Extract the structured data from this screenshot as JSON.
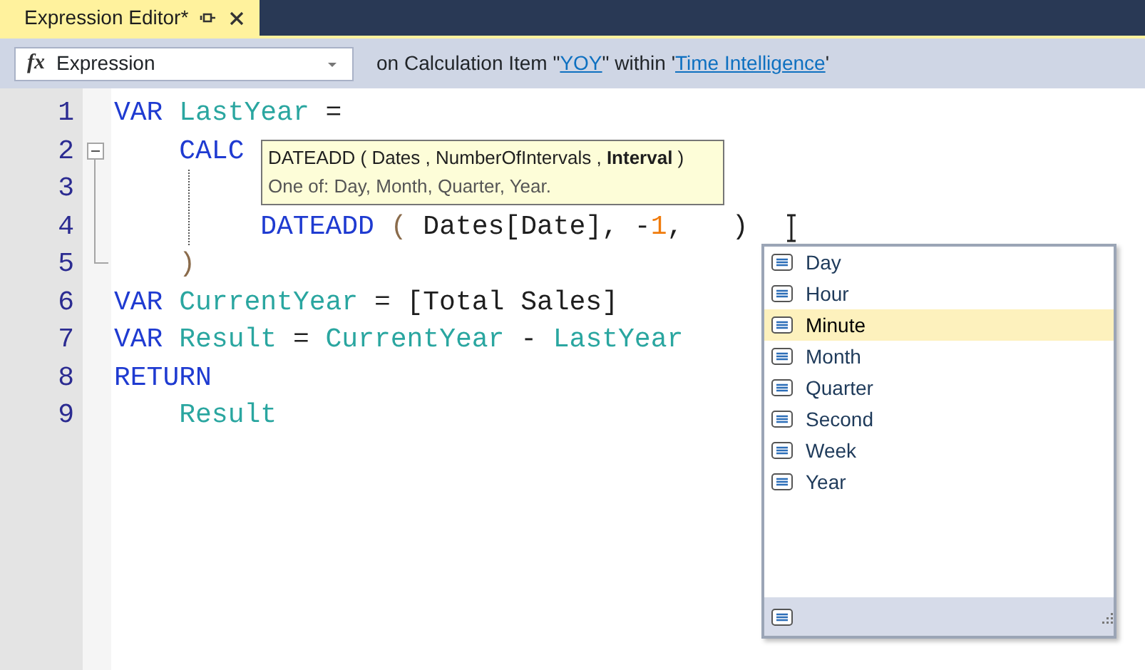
{
  "tab": {
    "title": "Expression Editor*",
    "selected": true
  },
  "toolbar": {
    "property_dropdown": {
      "icon_text": "fx",
      "value": "Expression"
    },
    "context": {
      "prefix": "on Calculation Item \"",
      "item_link": "YOY",
      "middle": "\" within '",
      "table_link": "Time Intelligence",
      "suffix": "'"
    }
  },
  "code_lines": [
    {
      "number": "1",
      "kind": "plain",
      "tokens": [
        {
          "kind": "keyword",
          "text": "VAR"
        },
        {
          "kind": "variable",
          "text": " LastYear"
        },
        {
          "kind": "plain",
          "text": " ="
        }
      ]
    },
    {
      "number": "2",
      "kind": "fold_start",
      "tokens": [
        {
          "kind": "keyword",
          "text": "    CALC"
        }
      ]
    },
    {
      "number": "3",
      "kind": "fold_inside"
    },
    {
      "number": "4",
      "kind": "fold_inside",
      "tokens": [
        {
          "kind": "keyword",
          "text": "         DATEADD"
        },
        {
          "kind": "paren",
          "text": " ("
        },
        {
          "kind": "plain",
          "text": " Dates[Date], -"
        },
        {
          "kind": "number",
          "text": "1"
        },
        {
          "kind": "plain",
          "text": ",   )"
        }
      ]
    },
    {
      "number": "5",
      "kind": "fold_end",
      "tokens": [
        {
          "kind": "paren",
          "text": "    )"
        }
      ]
    },
    {
      "number": "6",
      "kind": "plain",
      "tokens": [
        {
          "kind": "keyword",
          "text": "VAR"
        },
        {
          "kind": "variable",
          "text": " CurrentYear"
        },
        {
          "kind": "plain",
          "text": " = [Total Sales]"
        }
      ]
    },
    {
      "number": "7",
      "kind": "plain",
      "tokens": [
        {
          "kind": "keyword",
          "text": "VAR"
        },
        {
          "kind": "variable",
          "text": " Result"
        },
        {
          "kind": "plain",
          "text": " ="
        },
        {
          "kind": "variable",
          "text": " CurrentYear"
        },
        {
          "kind": "plain",
          "text": " -"
        },
        {
          "kind": "variable",
          "text": " LastYear"
        }
      ]
    },
    {
      "number": "8",
      "kind": "plain",
      "tokens": [
        {
          "kind": "keyword",
          "text": "RETURN"
        }
      ]
    },
    {
      "number": "9",
      "kind": "plain",
      "tokens": [
        {
          "kind": "variable",
          "text": "    Result"
        }
      ]
    }
  ],
  "signature_tooltip": {
    "signature": "DATEADD ( Dates , NumberOfIntervals , **Interval** )",
    "description": "One of: Day, Month, Quarter, Year."
  },
  "completion_list": {
    "items": [
      {
        "label": "Day",
        "selected": false
      },
      {
        "label": "Hour",
        "selected": false
      },
      {
        "label": "Minute",
        "selected": true
      },
      {
        "label": "Month",
        "selected": false
      },
      {
        "label": "Quarter",
        "selected": false
      },
      {
        "label": "Second",
        "selected": false
      },
      {
        "label": "Week",
        "selected": false
      },
      {
        "label": "Year",
        "selected": false
      }
    ]
  }
}
